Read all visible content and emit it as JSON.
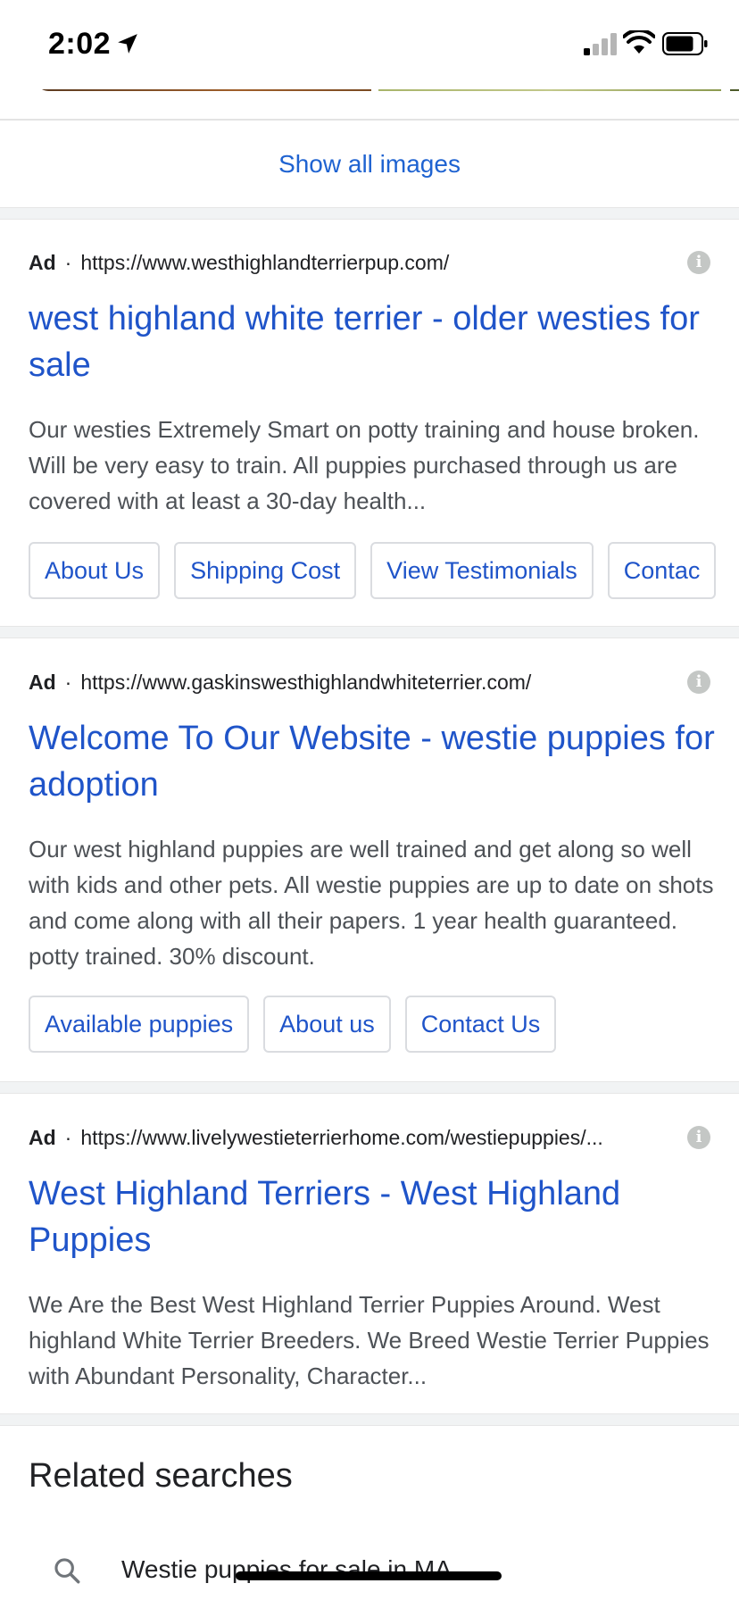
{
  "status_bar": {
    "time": "2:02"
  },
  "images": {
    "show_all_label": "Show all images"
  },
  "ads": [
    {
      "badge": "Ad",
      "url": "https://www.westhighlandterrierpup.com/",
      "title": "west highland white terrier - older westies for sale",
      "description": "Our westies Extremely Smart on potty training and house broken. Will be very easy to train. All puppies purchased through us are covered with at least a 30-day health...",
      "sitelinks": [
        "About Us",
        "Shipping Cost",
        "View Testimonials",
        "Contac"
      ]
    },
    {
      "badge": "Ad",
      "url": "https://www.gaskinswesthighlandwhiteterrier.com/",
      "title": "Welcome To Our Website - westie puppies for adoption",
      "description": "Our west highland puppies are well trained and get along so well with kids and other pets. All westie puppies are up to date on shots and come along with all their papers. 1 year health guaranteed. potty trained. 30% discount.",
      "sitelinks": [
        "Available puppies",
        "About us",
        "Contact Us"
      ]
    },
    {
      "badge": "Ad",
      "url": "https://www.livelywestieterrierhome.com/westiepuppies/...",
      "title": "West Highland Terriers - West Highland Puppies",
      "description": "We Are the Best West Highland Terrier Puppies Around. West highland White Terrier Breeders. We Breed Westie Terrier Puppies with Abundant Personality, Character...",
      "sitelinks": []
    }
  ],
  "related": {
    "title": "Related searches",
    "items": [
      "Westie puppies for sale in MA"
    ]
  },
  "icons": {
    "info": "info-icon",
    "search": "search-icon"
  }
}
